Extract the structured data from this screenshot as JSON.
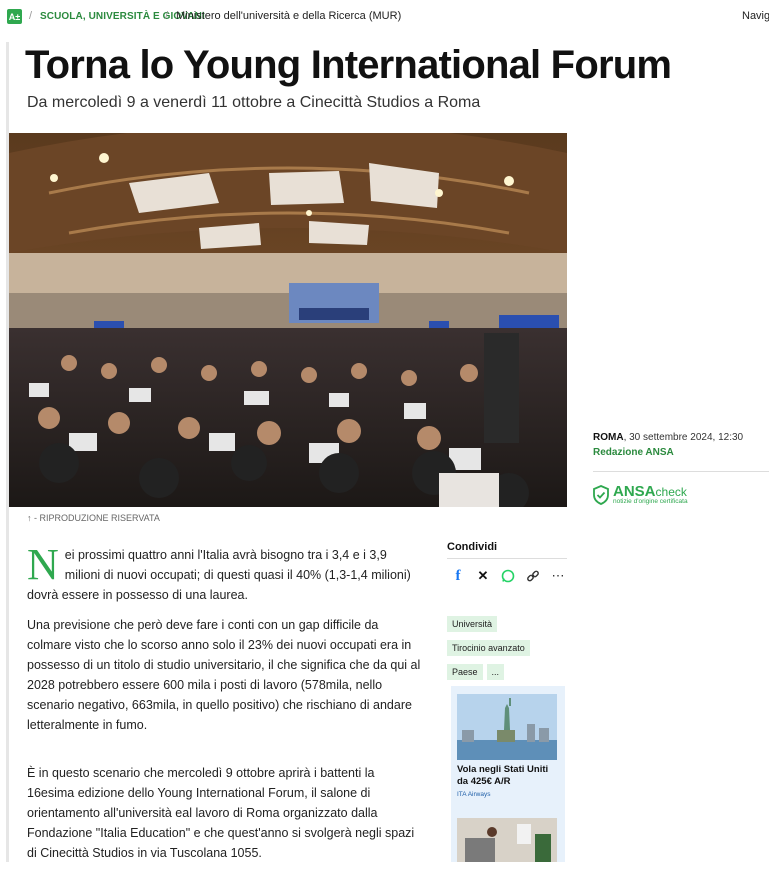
{
  "breadcrumb": {
    "logo_text": "A±",
    "section": "SCUOLA, UNIVERSITÀ E GIOVANI",
    "subject": "Ministero dell'università e della Ricerca (MUR)",
    "nav_label": "Navig"
  },
  "article": {
    "title": "Torna lo Young International Forum",
    "subtitle": "Da mercoledì 9 a venerdì 11 ottobre a Cinecittà Studios a Roma",
    "image_caption": "↑ - RIPRODUZIONE RISERVATA",
    "dropcap": "N",
    "paragraph1": "ei prossimi quattro anni l'Italia avrà bisogno tra i 3,4 e i 3,9 milioni di nuovi occupati; di questi quasi il 40% (1,3-1,4 milioni) dovrà essere in possesso di una laurea.",
    "paragraph2": "Una previsione che però deve fare i conti con un gap difficile da colmare visto che lo scorso anno solo il 23% dei nuovi occupati era in possesso di un titolo di studio universitario, il che significa che da qui al 2028 potrebbero essere 600 mila i posti di lavoro (578mila, nello scenario negativo, 663mila, in quello positivo) che rischiano di andare letteralmente in fumo.",
    "paragraph3": "È in questo scenario che mercoledì 9 ottobre aprirà i battenti la 16esima edizione dello Young International Forum, il salone di orientamento all'università eal lavoro di Roma organizzato dalla Fondazione \"Italia Education\" e che quest'anno si svolgerà negli spazi di Cinecittà Studios in via Tuscolana 1055."
  },
  "meta": {
    "city": "ROMA",
    "date": ", 30 settembre 2024, 12:30",
    "author": "Redazione ANSA",
    "ansacheck_brand": "ANSA",
    "ansacheck_suffix": "check",
    "ansacheck_tagline": "notizie d'origine certificata"
  },
  "share": {
    "title": "Condividi",
    "icons": [
      "facebook-icon",
      "x-icon",
      "whatsapp-icon",
      "link-icon",
      "more-icon"
    ]
  },
  "tags": [
    "Università",
    "Tirocinio avanzato",
    "Paese",
    "..."
  ],
  "ad": {
    "title": "Vola negli Stati Uniti da 425€ A/R",
    "source": "ITA Airways"
  },
  "colors": {
    "accent_green": "#2fa84f",
    "section_green": "#2b8a3e",
    "tag_bg": "#dff3e3",
    "ad_bg": "#e7f1fb"
  }
}
